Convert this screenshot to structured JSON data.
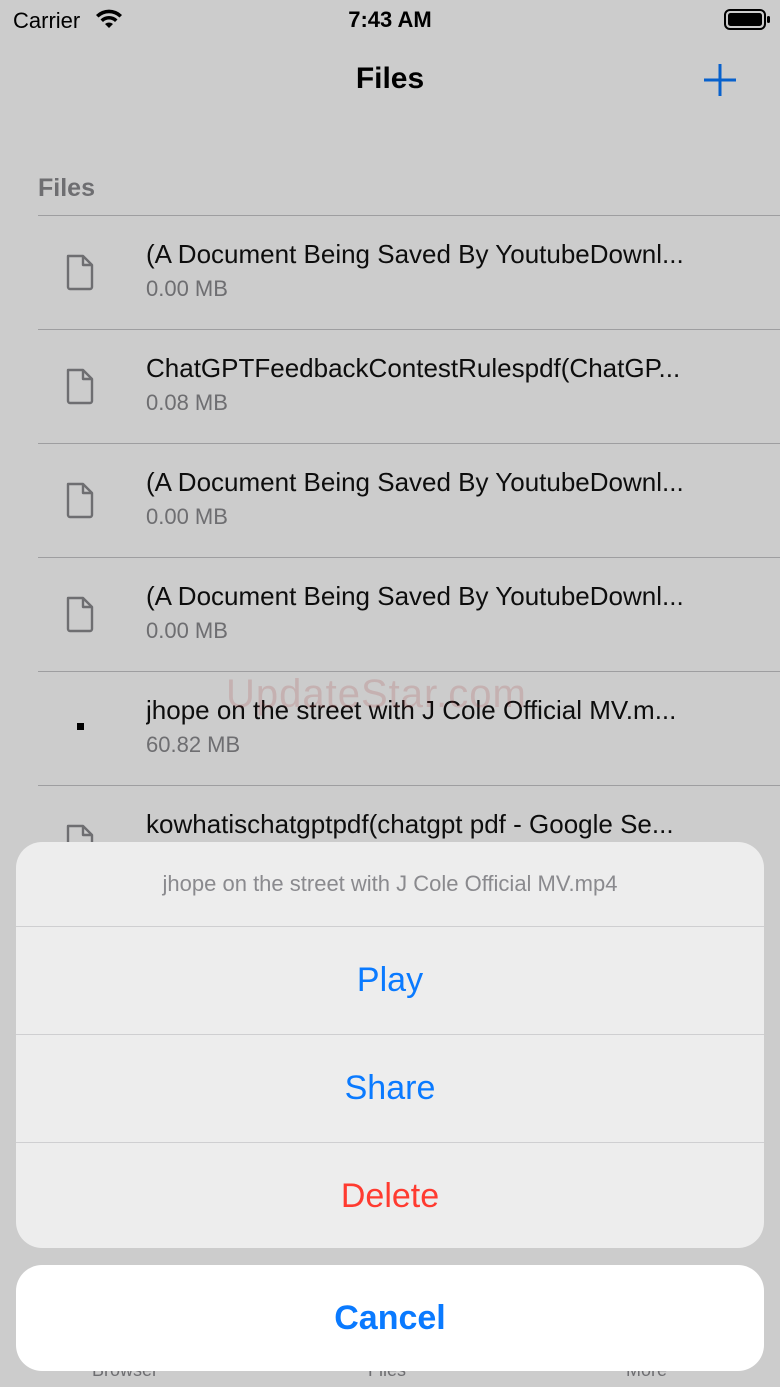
{
  "status_bar": {
    "carrier": "Carrier",
    "time": "7:43 AM"
  },
  "nav": {
    "title": "Files",
    "add_icon": "plus-icon"
  },
  "section": {
    "header": "Files"
  },
  "files": [
    {
      "name": "(A Document Being Saved By YoutubeDownl...",
      "size": "0.00 MB",
      "icon": "document-icon"
    },
    {
      "name": "ChatGPTFeedbackContestRulespdf(ChatGP...",
      "size": "0.08 MB",
      "icon": "document-icon"
    },
    {
      "name": "(A Document Being Saved By YoutubeDownl...",
      "size": "0.00 MB",
      "icon": "document-icon"
    },
    {
      "name": "(A Document Being Saved By YoutubeDownl...",
      "size": "0.00 MB",
      "icon": "document-icon"
    },
    {
      "name": "jhope on the street with J Cole Official MV.m...",
      "size": "60.82 MB",
      "icon": "video-thumbnail-icon"
    },
    {
      "name": "kowhatischatgptpdf(chatgpt pdf - Google Se...",
      "size": "",
      "icon": "document-icon"
    }
  ],
  "watermark": "UpdateStar.com",
  "tab_bar": {
    "browser": "Browser",
    "files": "Files",
    "more": "More"
  },
  "action_sheet": {
    "title": "jhope on the street with J Cole Official MV.mp4",
    "play": "Play",
    "share": "Share",
    "delete": "Delete",
    "cancel": "Cancel"
  },
  "colors": {
    "accent": "#0a7aff",
    "destructive": "#ff3b30",
    "secondary_text": "#8a8a8e"
  }
}
